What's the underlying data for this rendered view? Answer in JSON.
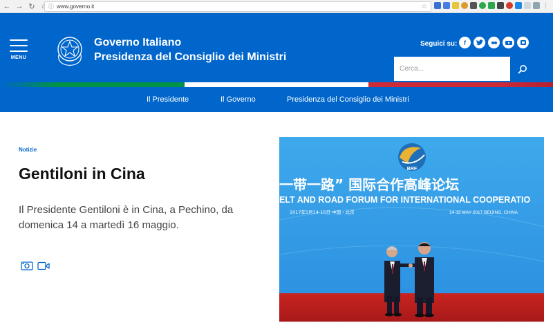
{
  "browser": {
    "url": "www.governo.it"
  },
  "header": {
    "menu_label": "MENU",
    "brand_title": "Governo Italiano",
    "brand_subtitle": "Presidenza del Consiglio dei Ministri",
    "follow_label": "Seguici su:",
    "socials": [
      "facebook",
      "twitter",
      "flickr",
      "youtube",
      "gplus"
    ],
    "search_placeholder": "Cerca..."
  },
  "colors": {
    "primary_blue": "#0066cc",
    "flag_green": "#009246",
    "flag_white": "#ffffff",
    "flag_red": "#ce2b37"
  },
  "nav": {
    "items": [
      "Il Presidente",
      "Il Governo",
      "Presidenza del Consiglio dei Ministri"
    ]
  },
  "article": {
    "category": "Notizie",
    "title": "Gentiloni in Cina",
    "summary": "Il Presidente Gentiloni è in Cina, a Pechino, da domenica 14 a martedì 16 maggio.",
    "photo": {
      "logo_text": "BRF",
      "banner_chinese": "一带一路” 国际合作高峰论坛",
      "banner_english": "ELT AND ROAD FORUM FOR INTERNATIONAL COOPERATIO",
      "date_left": "2017年5月14-15日   中国・北京",
      "date_right": "14-15 MAY 2017  BEIJING, CHINA"
    }
  }
}
